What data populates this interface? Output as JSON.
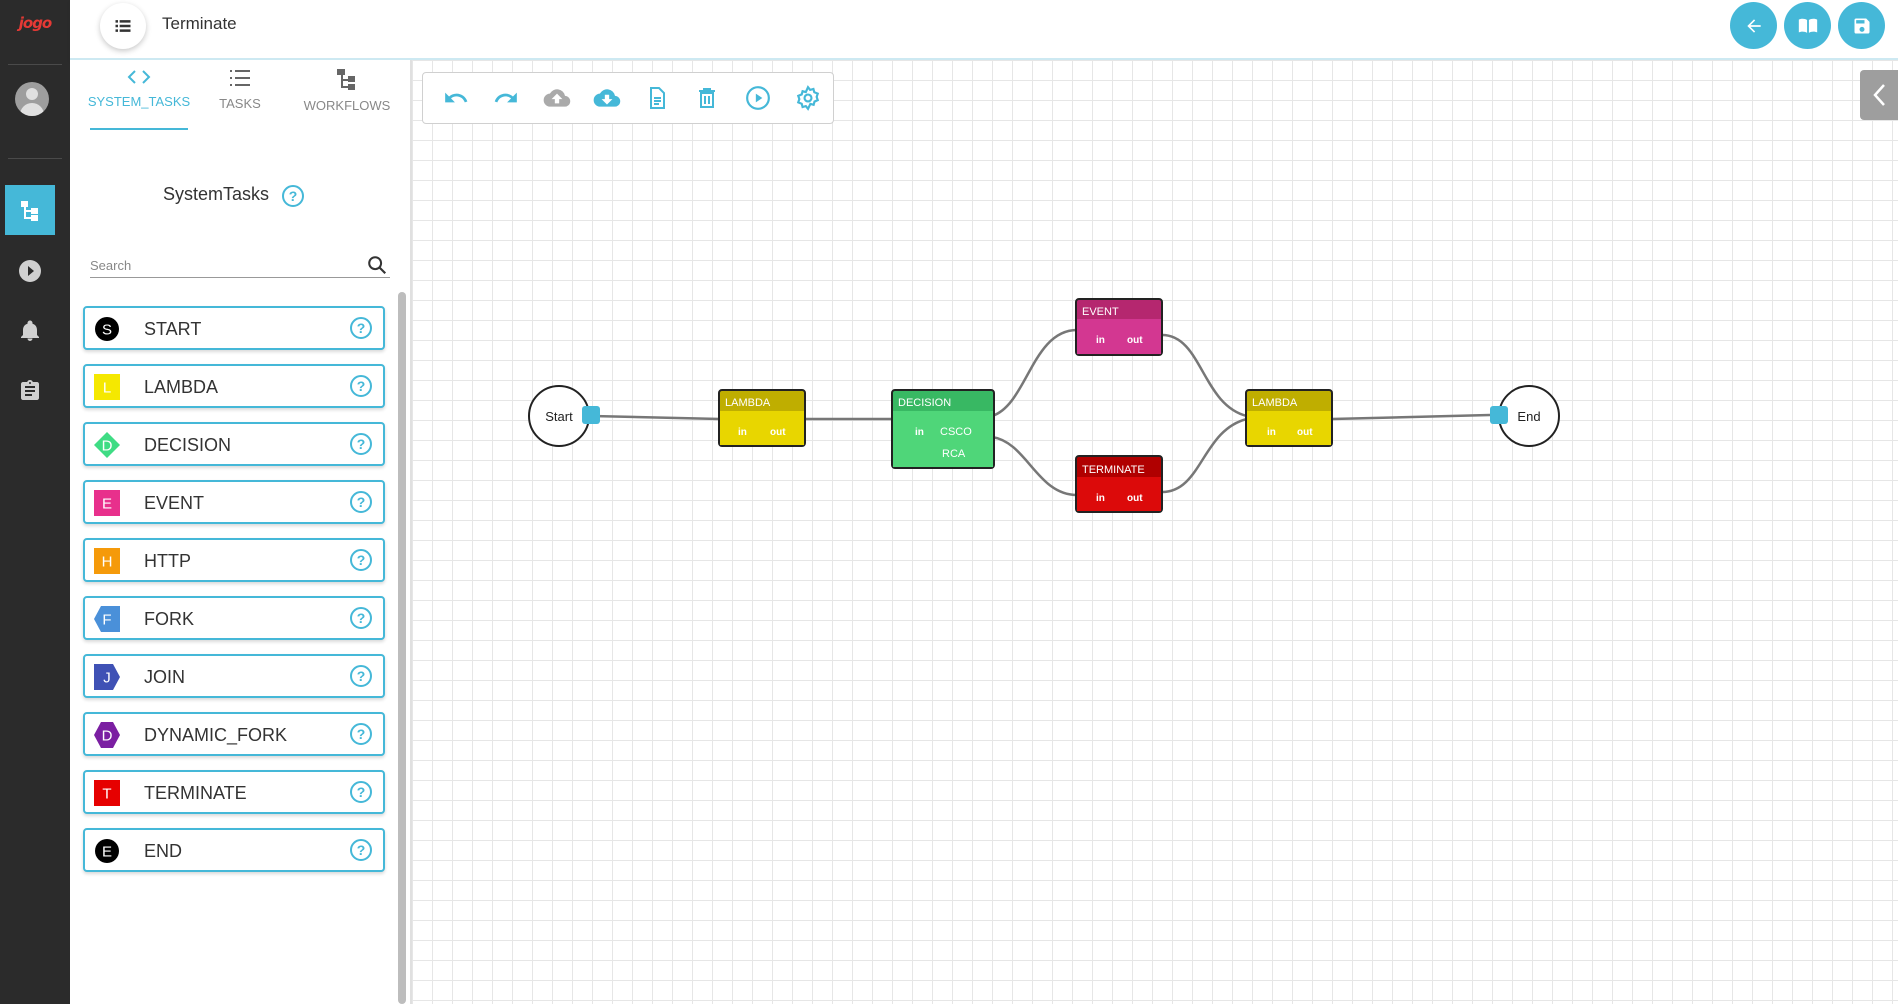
{
  "app": {
    "logo_text": "jogo"
  },
  "header": {
    "title": "Terminate"
  },
  "sidebar": {
    "tabs": [
      {
        "label": "SYSTEM_TASKS",
        "icon": "code-icon",
        "active": true
      },
      {
        "label": "TASKS",
        "icon": "list-icon",
        "active": false
      },
      {
        "label": "WORKFLOWS",
        "icon": "workflow-icon",
        "active": false
      }
    ],
    "panel_title": "SystemTasks",
    "search_placeholder": "Search",
    "tasks": [
      {
        "label": "START",
        "letter": "S",
        "color": "#000000",
        "shape": "circle"
      },
      {
        "label": "LAMBDA",
        "letter": "L",
        "color": "#f5e800",
        "shape": "square"
      },
      {
        "label": "DECISION",
        "letter": "D",
        "color": "#3fdc84",
        "shape": "diamond"
      },
      {
        "label": "EVENT",
        "letter": "E",
        "color": "#e8308c",
        "shape": "square"
      },
      {
        "label": "HTTP",
        "letter": "H",
        "color": "#f59a0a",
        "shape": "square"
      },
      {
        "label": "FORK",
        "letter": "F",
        "color": "#4a90d9",
        "shape": "arrow-left"
      },
      {
        "label": "JOIN",
        "letter": "J",
        "color": "#3f51b5",
        "shape": "arrow-right"
      },
      {
        "label": "DYNAMIC_FORK",
        "letter": "D",
        "color": "#7b1fa2",
        "shape": "hexagon"
      },
      {
        "label": "TERMINATE",
        "letter": "T",
        "color": "#e60000",
        "shape": "square"
      },
      {
        "label": "END",
        "letter": "E",
        "color": "#000000",
        "shape": "circle"
      }
    ]
  },
  "toolbar": {
    "tools": [
      "undo-icon",
      "redo-icon",
      "cloud-upload-icon",
      "cloud-download-icon",
      "document-icon",
      "delete-icon",
      "play-icon",
      "settings-icon"
    ]
  },
  "workflow": {
    "nodes": {
      "start": {
        "label": "Start"
      },
      "lambda1": {
        "label": "LAMBDA",
        "in": "in",
        "out": "out",
        "color": "#c8b800"
      },
      "decision": {
        "label": "DECISION",
        "in": "in",
        "case1": "CSCO",
        "case2": "RCA",
        "color": "#3cc46a"
      },
      "event": {
        "label": "EVENT",
        "in": "in",
        "out": "out",
        "color": "#c2287a"
      },
      "terminate": {
        "label": "TERMINATE",
        "in": "in",
        "out": "out",
        "color": "#c80000"
      },
      "lambda2": {
        "label": "LAMBDA",
        "in": "in",
        "out": "out",
        "color": "#c8b800"
      },
      "end": {
        "label": "End"
      }
    }
  },
  "colors": {
    "accent": "#45b8d8",
    "rail": "#2b2b2b"
  }
}
